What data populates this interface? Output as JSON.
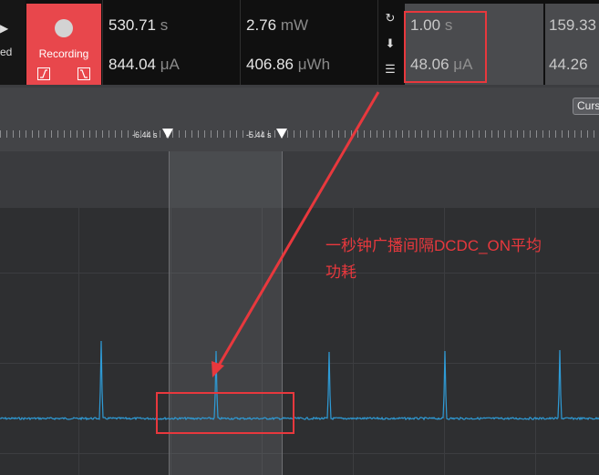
{
  "toolbar": {
    "left_partial": {
      "play_glyph": "▶",
      "label": "ed"
    },
    "record_button": {
      "label": "Recording"
    },
    "trigger_rising_icon": "rising-edge-icon",
    "trigger_falling_icon": "falling-edge-icon",
    "metrics": [
      {
        "value": "530.71",
        "unit": "s"
      },
      {
        "value": "844.04",
        "unit": "μA"
      },
      {
        "value": "2.76",
        "unit": "mW"
      },
      {
        "value": "406.86",
        "unit": "μWh"
      }
    ],
    "side_icons": [
      "reset-icon",
      "download-icon",
      "list-icon"
    ],
    "selection_metrics": [
      {
        "value": "1.00",
        "unit": "s"
      },
      {
        "value": "48.06",
        "unit": "μA"
      }
    ],
    "partial_metrics": [
      {
        "value": "159.33"
      },
      {
        "value": "44.26"
      }
    ]
  },
  "ruler": {
    "cursor_button": "Curs",
    "markers": [
      {
        "label": "-6.44 s"
      },
      {
        "label": "-5.44 s"
      }
    ]
  },
  "annotation": {
    "line1": "一秒钟广播间隔DCDC_ON平均",
    "line2": "功耗"
  },
  "colors": {
    "record": "#e8474c",
    "trace": "#2e9bd6",
    "annotation": "#e8383d"
  }
}
